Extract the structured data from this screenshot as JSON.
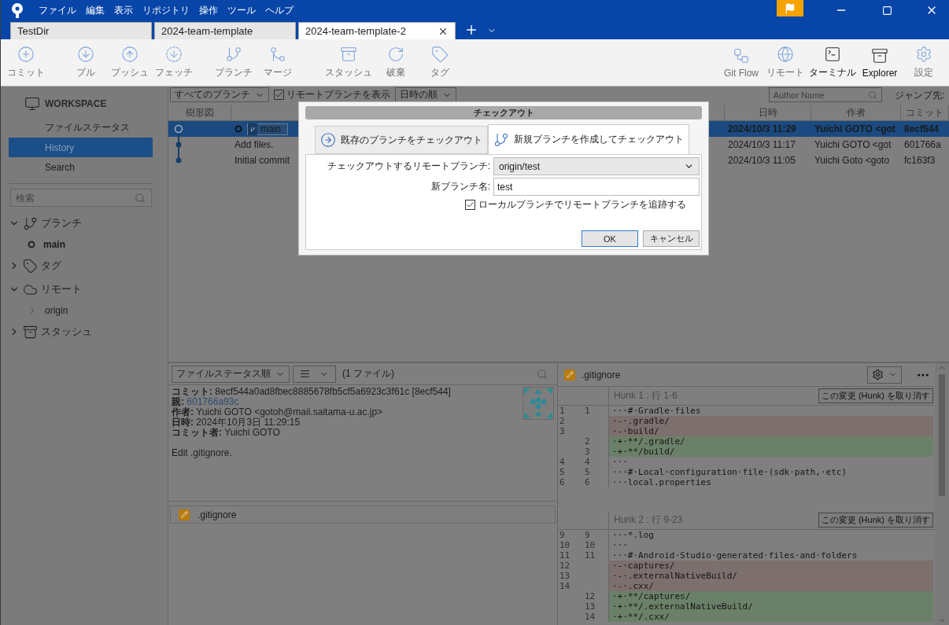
{
  "menu": [
    "ファイル",
    "編集",
    "表示",
    "リポジトリ",
    "操作",
    "ツール",
    "ヘルプ"
  ],
  "repo_tabs": [
    {
      "label": "TestDir",
      "selected": false
    },
    {
      "label": "2024-team-template",
      "selected": false
    },
    {
      "label": "2024-team-template-2",
      "selected": true
    }
  ],
  "toolbar": [
    {
      "label": "コミット",
      "disabled": true
    },
    {
      "label": "プル",
      "disabled": true
    },
    {
      "label": "プッシュ",
      "disabled": true
    },
    {
      "label": "フェッチ",
      "disabled": true
    },
    {
      "label": "ブランチ",
      "disabled": true
    },
    {
      "label": "マージ",
      "disabled": true
    },
    {
      "label": "スタッシュ",
      "disabled": true
    },
    {
      "label": "破棄",
      "disabled": true
    },
    {
      "label": "タグ",
      "disabled": true
    }
  ],
  "toolbar_right": [
    {
      "label": "Git Flow",
      "disabled": true
    },
    {
      "label": "リモート",
      "disabled": true
    },
    {
      "label": "ターミナル",
      "disabled": false
    },
    {
      "label": "Explorer",
      "disabled": false
    },
    {
      "label": "設定",
      "disabled": true
    }
  ],
  "sidebar": {
    "workspace": "WORKSPACE",
    "items": [
      {
        "label": "ファイルステータス",
        "selected": false
      },
      {
        "label": "History",
        "selected": true
      },
      {
        "label": "Search",
        "selected": false
      }
    ],
    "search": {
      "placeholder": "検索"
    },
    "sections": [
      {
        "label": "ブランチ",
        "expanded": true,
        "children": [
          {
            "label": "main",
            "current": true
          }
        ]
      },
      {
        "label": "タグ",
        "expanded": false
      },
      {
        "label": "リモート",
        "expanded": true,
        "children": [
          {
            "label": "origin",
            "current": false
          }
        ]
      },
      {
        "label": "スタッシュ",
        "expanded": false
      }
    ]
  },
  "filter": {
    "branches": "すべてのブランチ",
    "show_remote": {
      "label": "リモートブランチを表示",
      "checked": true
    },
    "order": "日時の順",
    "author": {
      "placeholder": "Author Name"
    },
    "jump": "ジャンプ先:"
  },
  "table": {
    "columns": [
      "樹形図",
      "日時",
      "作者",
      "コミット"
    ],
    "rows": [
      {
        "tags": [
          "main"
        ],
        "date": "2024/10/3  11:29",
        "author": "Yuichi GOTO <got",
        "commit": "8ecf544",
        "selected": true
      },
      {
        "tags": [],
        "description": "Add files.",
        "date": "2024/10/3  11:17",
        "author": "Yuichi GOTO <got",
        "commit": "601766a",
        "selected": false
      },
      {
        "tags": [],
        "description": "Initial commit",
        "date": "2024/10/3  11:05",
        "author": "Yuichi Goto <goto",
        "commit": "fc163f3",
        "selected": false
      }
    ]
  },
  "files_toolbar": {
    "sort": "ファイルステータス順",
    "count": "(1 ファイル)"
  },
  "details": [
    {
      "label": "コミット:",
      "value": "8ecf544a0ad8fbec8885678fb5cf5a6923c3f61c [8ecf544]",
      "kind": "text"
    },
    {
      "label": "親:",
      "value": "601766a93c",
      "kind": "link"
    },
    {
      "label": "作者:",
      "value": "Yuichi GOTO <gotoh@mail.saitama-u.ac.jp>",
      "kind": "text"
    },
    {
      "label": "日時:",
      "value": "2024年10月3日 11:29:15",
      "kind": "text"
    },
    {
      "label": "コミット者:",
      "value": "Yuichi GOTO",
      "kind": "text"
    }
  ],
  "message": "Edit .gitignore.",
  "files": [
    {
      "name": ".gitignore"
    }
  ],
  "diff": {
    "file": ".gitignore",
    "hunks": [
      {
        "header": "Hunk 1 : 行 1-6",
        "discard": "この変更 (Hunk) を取り消す",
        "lines": [
          {
            "old": "1",
            "new": "1",
            "kind": "context",
            "text": "···#·Gradle·files"
          },
          {
            "old": "2",
            "kind": "removed",
            "text": "·-·.gradle/"
          },
          {
            "old": "3",
            "kind": "removed",
            "text": "·-·build/"
          },
          {
            "new": "2",
            "kind": "added",
            "text": "·+·**/.gradle/"
          },
          {
            "new": "3",
            "kind": "added",
            "text": "·+·**/build/"
          },
          {
            "old": "4",
            "new": "4",
            "kind": "context",
            "text": "···"
          },
          {
            "old": "5",
            "new": "5",
            "kind": "context",
            "text": "···#·Local·configuration·file·(sdk·path,·etc)"
          },
          {
            "old": "6",
            "new": "6",
            "kind": "context",
            "text": "···local.properties"
          }
        ]
      },
      {
        "header": "Hunk 2 : 行 9-23",
        "discard": "この変更 (Hunk) を取り消す",
        "lines": [
          {
            "old": "9",
            "new": "9",
            "kind": "context",
            "text": "···*.log"
          },
          {
            "old": "10",
            "new": "10",
            "kind": "context",
            "text": "···"
          },
          {
            "old": "11",
            "new": "11",
            "kind": "context",
            "text": "···#·Android·Studio·generated·files·and·folders"
          },
          {
            "old": "12",
            "kind": "removed",
            "text": "·-·captures/"
          },
          {
            "old": "13",
            "kind": "removed",
            "text": "·-·.externalNativeBuild/"
          },
          {
            "old": "14",
            "kind": "removed",
            "text": "·-·.cxx/"
          },
          {
            "new": "12",
            "kind": "added",
            "text": "·+·**/captures/"
          },
          {
            "new": "13",
            "kind": "added",
            "text": "·+·**/.externalNativeBuild/"
          },
          {
            "new": "14",
            "kind": "added",
            "text": "·+·**/.cxx/"
          }
        ]
      }
    ]
  },
  "dialog": {
    "title": "チェックアウト",
    "tabs": [
      {
        "label": "既存のブランチをチェックアウト",
        "selected": false
      },
      {
        "label": "新規ブランチを作成してチェックアウト",
        "selected": true
      }
    ],
    "remote_label": "チェックアウトするリモートブランチ:",
    "remote_value": "origin/test",
    "name_label": "新ブランチ名:",
    "name_value": "test",
    "track": {
      "label": "ローカルブランチでリモートブランチを追跡する",
      "checked": true
    },
    "buttons": [
      "OK",
      "キャンセル"
    ]
  }
}
